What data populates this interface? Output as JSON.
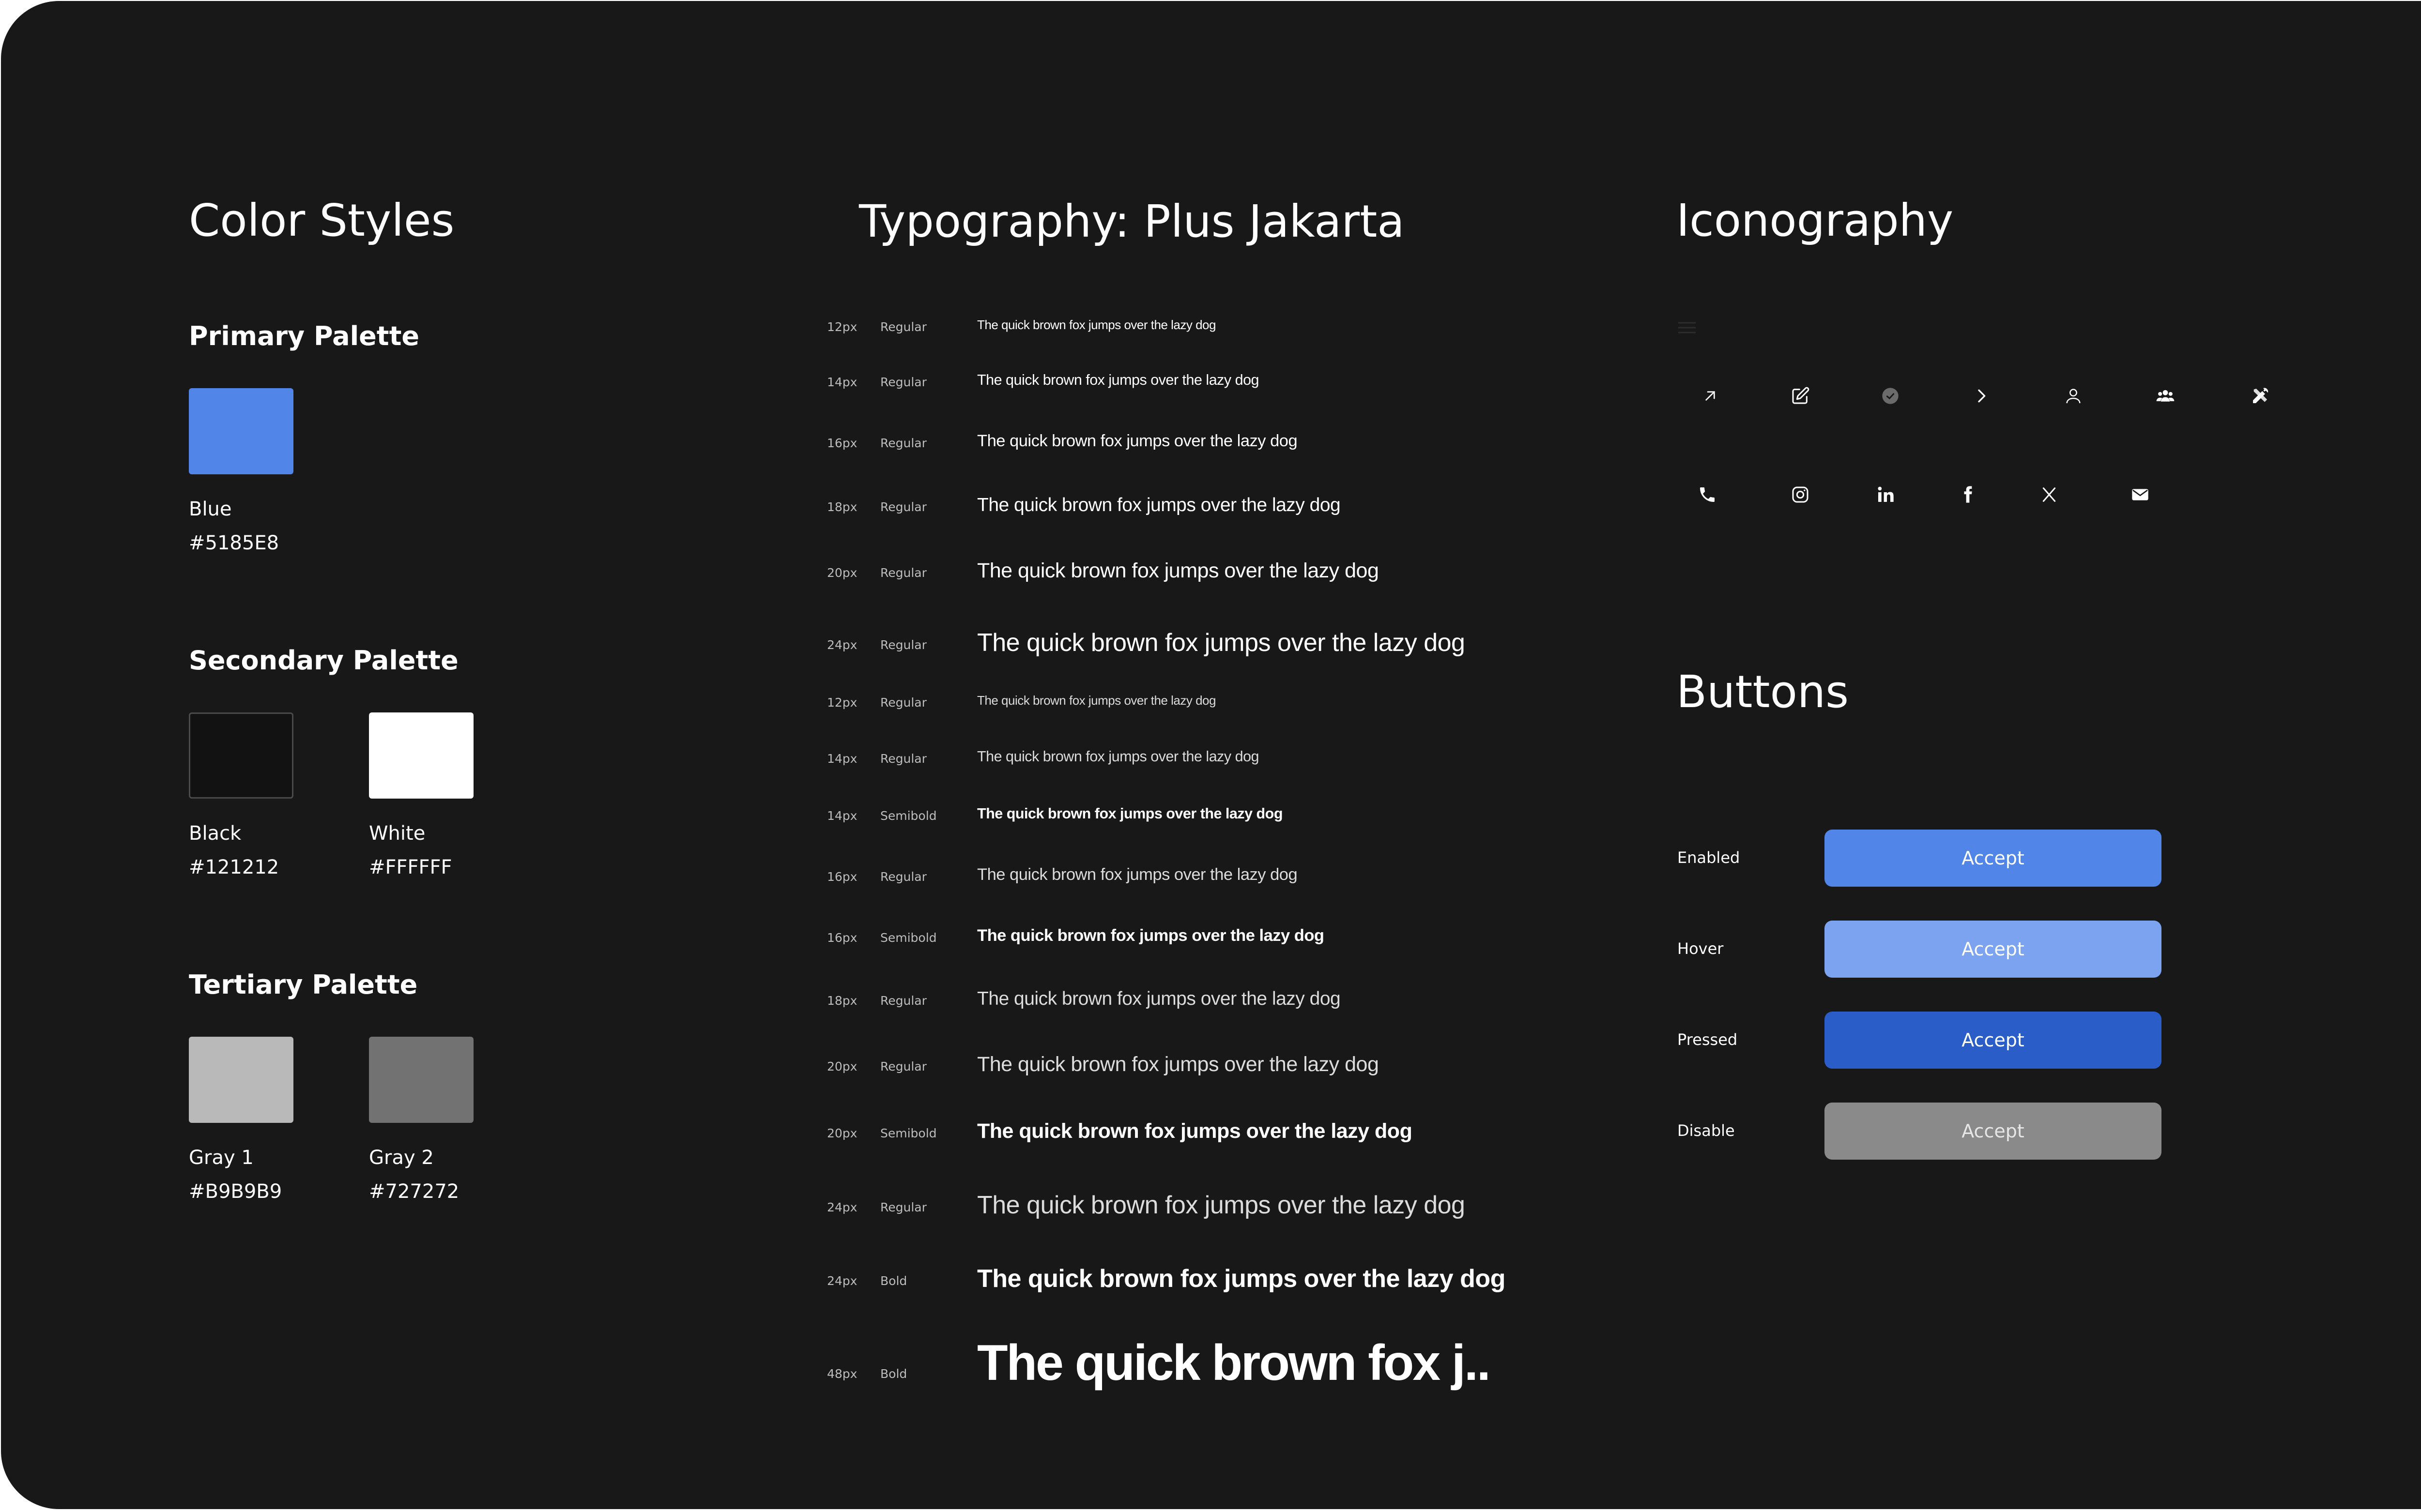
{
  "color_styles": {
    "title": "Color Styles",
    "primary": {
      "heading": "Primary Palette",
      "swatches": [
        {
          "name": "Blue",
          "hex": "#5185E8",
          "color": "#5185E8"
        }
      ]
    },
    "secondary": {
      "heading": "Secondary Palette",
      "swatches": [
        {
          "name": "Black",
          "hex": "#121212",
          "color": "#121212"
        },
        {
          "name": "White",
          "hex": "#FFFFFF",
          "color": "#FFFFFF"
        }
      ]
    },
    "tertiary": {
      "heading": "Tertiary Palette",
      "swatches": [
        {
          "name": "Gray 1",
          "hex": "#B9B9B9",
          "color": "#B9B9B9"
        },
        {
          "name": "Gray 2",
          "hex": "#727272",
          "color": "#727272"
        }
      ]
    }
  },
  "typography": {
    "title": "Typography: Plus Jakarta",
    "rows": [
      {
        "size_label": "12px",
        "weight_label": "Regular",
        "sample": "The quick brown fox jumps over the lazy dog",
        "weight": 500,
        "color": "#ffffff"
      },
      {
        "size_label": "14px",
        "weight_label": "Regular",
        "sample": "The quick brown fox jumps over the lazy dog",
        "weight": 500,
        "color": "#ffffff"
      },
      {
        "size_label": "16px",
        "weight_label": "Regular",
        "sample": "The quick brown fox jumps over the lazy dog",
        "weight": 500,
        "color": "#ffffff"
      },
      {
        "size_label": "18px",
        "weight_label": "Regular",
        "sample": "The quick brown fox jumps over the lazy dog",
        "weight": 500,
        "color": "#ffffff"
      },
      {
        "size_label": "20px",
        "weight_label": "Regular",
        "sample": "The quick brown fox jumps over the lazy dog",
        "weight": 500,
        "color": "#ffffff"
      },
      {
        "size_label": "24px",
        "weight_label": "Regular",
        "sample": "The quick brown fox jumps over the lazy dog",
        "weight": 500,
        "color": "#ffffff"
      },
      {
        "size_label": "12px",
        "weight_label": "Regular",
        "sample": "The quick brown fox jumps over the lazy dog",
        "weight": 400,
        "color": "#dcdcdc"
      },
      {
        "size_label": "14px",
        "weight_label": "Regular",
        "sample": "The quick brown fox jumps over the lazy dog",
        "weight": 400,
        "color": "#dcdcdc"
      },
      {
        "size_label": "14px",
        "weight_label": "Semibold",
        "sample": "The quick brown fox jumps over the lazy dog",
        "weight": 700,
        "color": "#ffffff"
      },
      {
        "size_label": "16px",
        "weight_label": "Regular",
        "sample": "The quick brown fox jumps over the lazy dog",
        "weight": 400,
        "color": "#dcdcdc"
      },
      {
        "size_label": "16px",
        "weight_label": "Semibold",
        "sample": "The quick brown fox jumps over the lazy dog",
        "weight": 700,
        "color": "#ffffff"
      },
      {
        "size_label": "18px",
        "weight_label": "Regular",
        "sample": "The quick brown fox jumps over the lazy dog",
        "weight": 400,
        "color": "#dcdcdc"
      },
      {
        "size_label": "20px",
        "weight_label": "Regular",
        "sample": "The quick brown fox jumps over the lazy dog",
        "weight": 400,
        "color": "#dcdcdc"
      },
      {
        "size_label": "20px",
        "weight_label": "Semibold",
        "sample": "The quick brown fox jumps over the lazy dog",
        "weight": 700,
        "color": "#ffffff"
      },
      {
        "size_label": "24px",
        "weight_label": "Regular",
        "sample": "The quick brown fox jumps over the lazy dog",
        "weight": 400,
        "color": "#dcdcdc"
      },
      {
        "size_label": "24px",
        "weight_label": "Bold",
        "sample": "The quick brown fox jumps over the lazy dog",
        "weight": 700,
        "color": "#ffffff"
      },
      {
        "size_label": "48px",
        "weight_label": "Bold",
        "sample": "The quick brown fox j..",
        "weight": 700,
        "color": "#ffffff"
      }
    ]
  },
  "iconography": {
    "title": "Iconography",
    "row1": [
      "arrow-up-right-icon",
      "edit-icon",
      "check-circle-icon",
      "chevron-right-icon",
      "user-icon",
      "users-group-icon",
      "tools-icon"
    ],
    "row2": [
      "phone-icon",
      "instagram-icon",
      "linkedin-icon",
      "facebook-icon",
      "x-twitter-icon",
      "mail-icon"
    ]
  },
  "buttons": {
    "title": "Buttons",
    "states": [
      {
        "state": "Enabled",
        "label": "Accept",
        "color": "#5185E8",
        "text_color": "#ffffff"
      },
      {
        "state": "Hover",
        "label": "Accept",
        "color": "#7BA3F0",
        "text_color": "#ffffff"
      },
      {
        "state": "Pressed",
        "label": "Accept",
        "color": "#2A5DC8",
        "text_color": "#ffffff"
      },
      {
        "state": "Disable",
        "label": "Accept",
        "color": "#8A8A8A",
        "text_color": "#e6e6e6"
      }
    ]
  }
}
